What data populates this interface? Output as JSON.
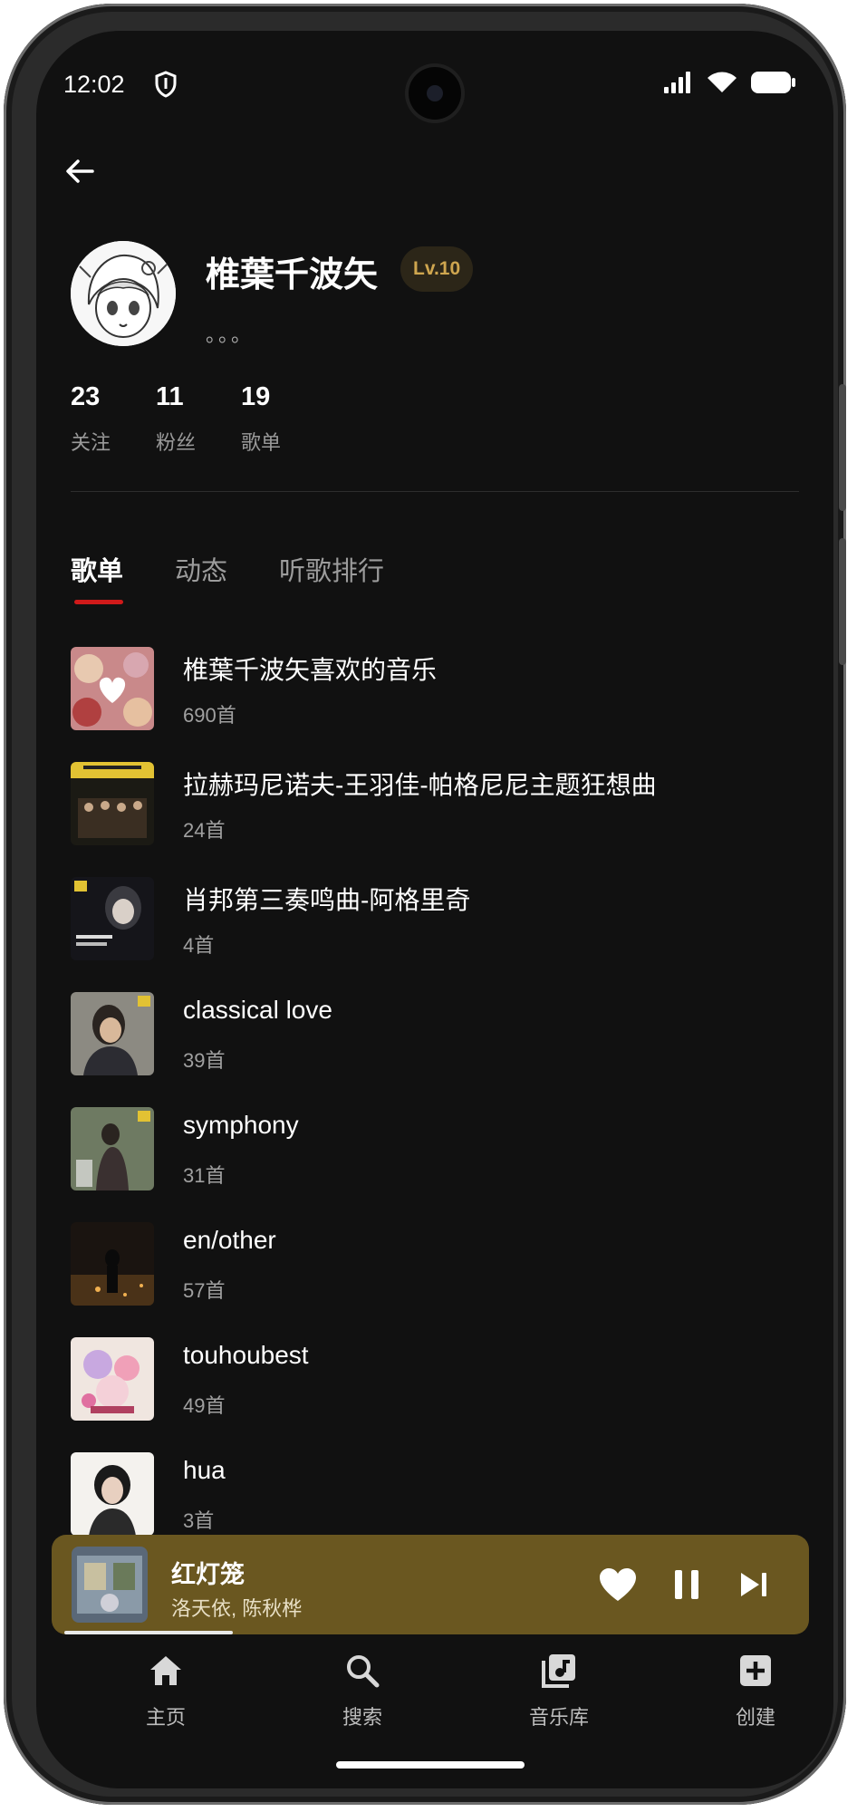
{
  "status_bar": {
    "time": "12:02"
  },
  "profile": {
    "username": "椎葉千波矢",
    "level": "Lv.10",
    "signature": "。。。",
    "stats": [
      {
        "num": "23",
        "label": "关注"
      },
      {
        "num": "11",
        "label": "粉丝"
      },
      {
        "num": "19",
        "label": "歌单"
      }
    ]
  },
  "tabs": [
    {
      "label": "歌单",
      "active": true
    },
    {
      "label": "动态",
      "active": false
    },
    {
      "label": "听歌排行",
      "active": false
    }
  ],
  "playlists": [
    {
      "title": "椎葉千波矢喜欢的音乐",
      "count": "690首"
    },
    {
      "title": "拉赫玛尼诺夫-王羽佳-帕格尼尼主题狂想曲",
      "count": "24首"
    },
    {
      "title": "肖邦第三奏鸣曲-阿格里奇",
      "count": "4首"
    },
    {
      "title": "classical love",
      "count": "39首"
    },
    {
      "title": "symphony",
      "count": "31首"
    },
    {
      "title": "en/other",
      "count": "57首"
    },
    {
      "title": "touhoubest",
      "count": "49首"
    },
    {
      "title": "hua",
      "count": "3首"
    }
  ],
  "player": {
    "title": "红灯笼",
    "artist": "洛天依, 陈秋桦",
    "progress": 0.23,
    "background": "#6a5720"
  },
  "nav": [
    {
      "label": "主页",
      "icon": "home-icon"
    },
    {
      "label": "搜索",
      "icon": "search-icon"
    },
    {
      "label": "音乐库",
      "icon": "library-icon"
    },
    {
      "label": "创建",
      "icon": "add-icon"
    }
  ],
  "colors": {
    "accent": "#d01a1a",
    "level_text": "#cfa64f",
    "background": "#111111"
  }
}
